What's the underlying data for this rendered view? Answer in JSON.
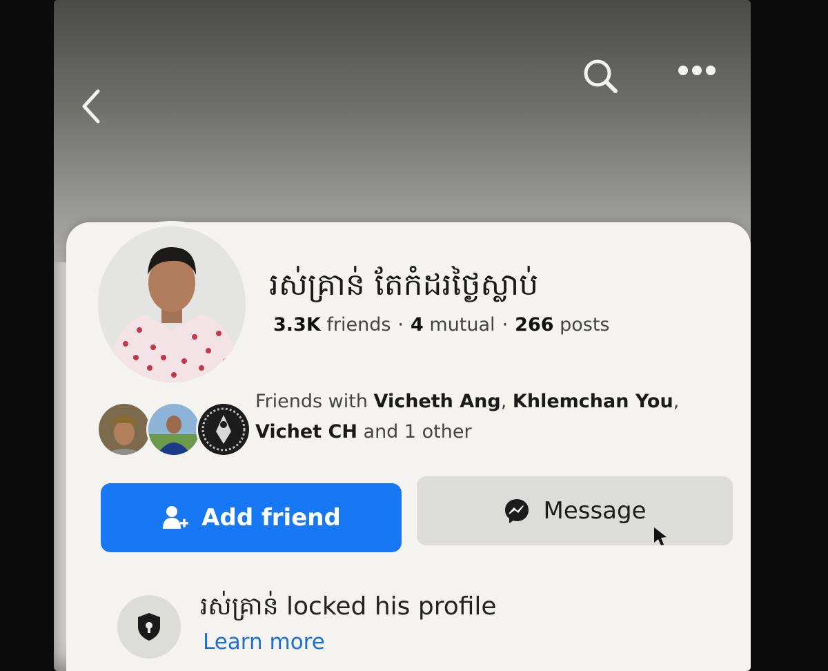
{
  "header": {
    "back_icon": "chevron-left-icon",
    "search_icon": "search-icon",
    "more_icon": "more-horizontal-icon"
  },
  "profile": {
    "name": "រស់គ្រាន់ តែកំដរថ្ងៃស្លាប់",
    "stats": {
      "friends_count": "3.3K",
      "friends_label": "friends",
      "mutual_count": "4",
      "mutual_label": "mutual",
      "posts_count": "266",
      "posts_label": "posts",
      "separator": "·"
    }
  },
  "mutual_friends": {
    "prefix": "Friends with ",
    "friend_1": "Vicheth Ang",
    "comma_1": ", ",
    "friend_2": "Khlemchan You",
    "comma_2": ",",
    "friend_3": "Vichet CH",
    "suffix": " and 1 other"
  },
  "actions": {
    "add_friend_label": "Add friend",
    "message_label": "Message"
  },
  "lock_notice": {
    "text": "រស់គ្រាន់ locked his profile",
    "link": "Learn more"
  },
  "colors": {
    "primary_button": "#1877f2",
    "secondary_button": "#dcdcda",
    "link": "#1b6fd8"
  }
}
